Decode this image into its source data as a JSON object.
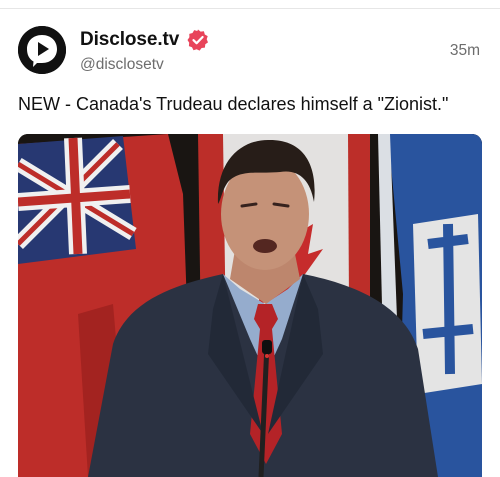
{
  "post": {
    "author": {
      "display_name": "Disclose.tv",
      "handle": "@disclosetv",
      "verified": true,
      "avatar_icon": "play-speech-bubble-icon"
    },
    "timestamp": "35m",
    "text": "NEW - Canada's Trudeau declares himself a \"Zionist.\"",
    "media": {
      "type": "video-thumbnail"
    }
  },
  "colors": {
    "verified_badge": "#e8445a",
    "handle_gray": "#6d6d6d",
    "text": "#111111"
  }
}
